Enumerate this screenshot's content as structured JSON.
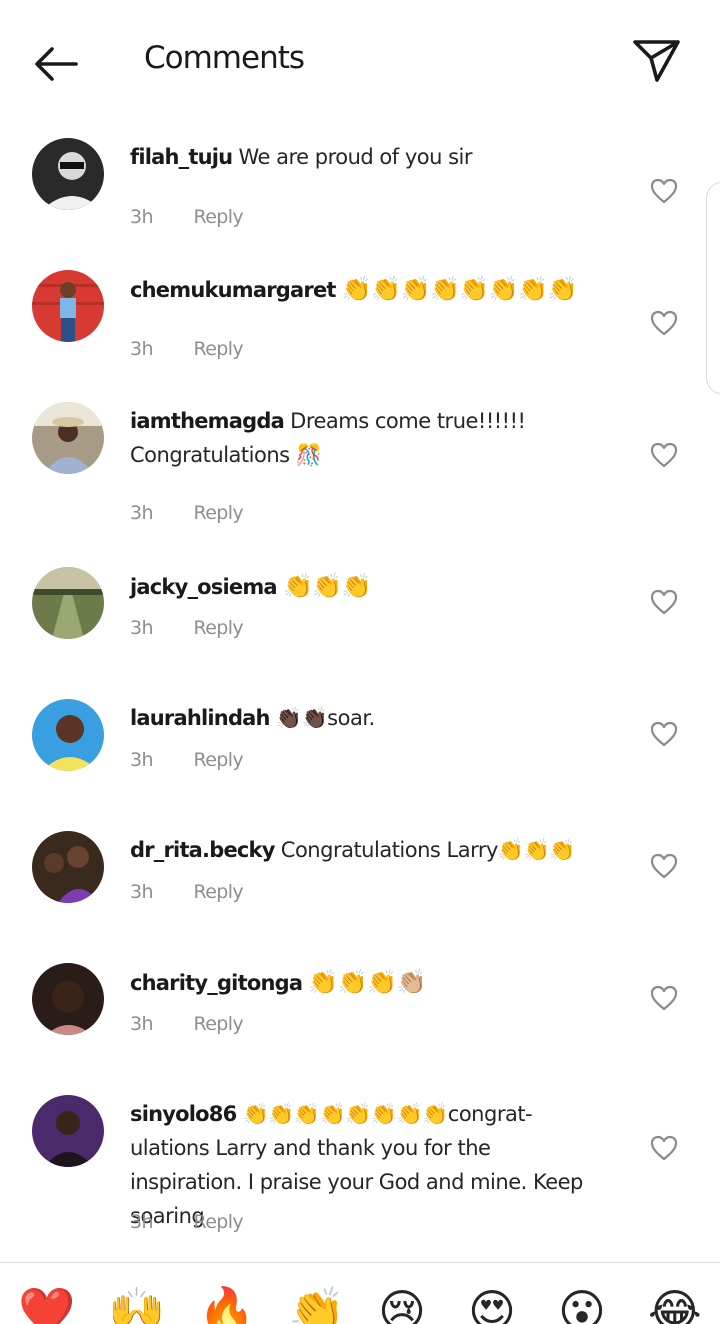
{
  "header": {
    "title": "Comments",
    "back_icon": "arrow-left-icon",
    "send_icon": "paper-plane-icon"
  },
  "comments": [
    {
      "username": "filah_tuju",
      "text": "We are proud of you sir",
      "time": "3h",
      "reply": "Reply",
      "avatar_colors": [
        "#1a1a1a",
        "#cfcfcf"
      ]
    },
    {
      "username": "chemukumargaret",
      "text": "👏👏👏👏👏👏👏👏",
      "time": "3h",
      "reply": "Reply",
      "avatar_colors": [
        "#d63a32",
        "#3a6fb0"
      ]
    },
    {
      "username": "iamthemagda",
      "text": "Dreams come true!!!!!! Congratulations 🎊",
      "time": "3h",
      "reply": "Reply",
      "avatar_colors": [
        "#9aa6b8",
        "#ece6d8"
      ]
    },
    {
      "username": "jacky_osiema",
      "text": "👏👏👏",
      "time": "3h",
      "reply": "Reply",
      "avatar_colors": [
        "#5b6b3a",
        "#a2ab86"
      ]
    },
    {
      "username": "laurahlindah",
      "text": "👏🏿👏🏿soar.",
      "time": "3h",
      "reply": "Reply",
      "avatar_colors": [
        "#3a9fe0",
        "#f2e35a"
      ]
    },
    {
      "username": "dr_rita.becky",
      "text": "Congratulations Larry👏👏👏",
      "time": "3h",
      "reply": "Reply",
      "avatar_colors": [
        "#3a2a1e",
        "#7d3cb0"
      ]
    },
    {
      "username": "charity_gitonga",
      "text": "👏👏👏👏🏼",
      "time": "3h",
      "reply": "Reply",
      "avatar_colors": [
        "#2a1c18",
        "#c98a86"
      ]
    },
    {
      "username": "sinyolo86",
      "text": "👏👏👏👏👏👏👏👏congrat-ulations Larry and thank you for the inspiration. I praise your God and mine. Keep soaring",
      "time": "3h",
      "reply": "Reply",
      "avatar_colors": [
        "#4a2a6a",
        "#1e1420"
      ]
    }
  ],
  "reactions": [
    "❤️",
    "🙌",
    "🔥",
    "👏",
    "😢",
    "😍",
    "😮",
    "😂"
  ],
  "icons": {
    "like": "heart-outline-icon"
  }
}
